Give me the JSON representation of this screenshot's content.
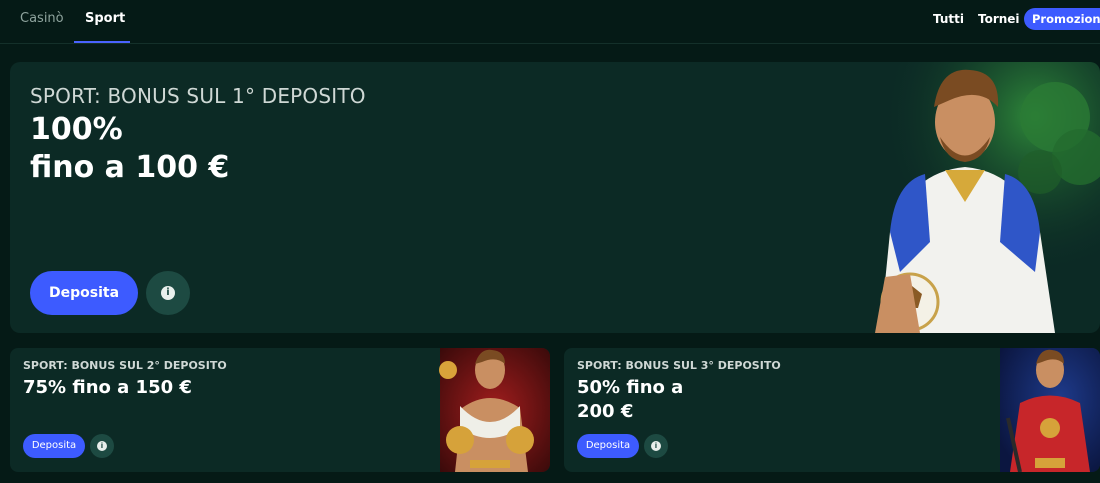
{
  "nav": {
    "tabs": [
      "Casinò",
      "Sport"
    ],
    "active_tab": "Sport",
    "filters": [
      "Tutti",
      "Tornei",
      "Promozioni"
    ],
    "active_filter": "Promozioni"
  },
  "hero": {
    "eyebrow": "SPORT: BONUS SUL 1° DEPOSITO",
    "line1": "100%",
    "line2": "fino a 100 €",
    "deposit_label": "Deposita"
  },
  "cards": [
    {
      "eyebrow": "SPORT: BONUS SUL 2° DEPOSITO",
      "title_line1": "75% fino a 150 €",
      "title_line2": "",
      "deposit_label": "Deposita"
    },
    {
      "eyebrow": "SPORT: BONUS SUL 3° DEPOSITO",
      "title_line1": "50% fino a",
      "title_line2": "200 €",
      "deposit_label": "Deposita"
    }
  ],
  "colors": {
    "background": "#051a16",
    "card": "#0c2a25",
    "accent": "#3d5bff",
    "info_button": "#1d4a42"
  }
}
